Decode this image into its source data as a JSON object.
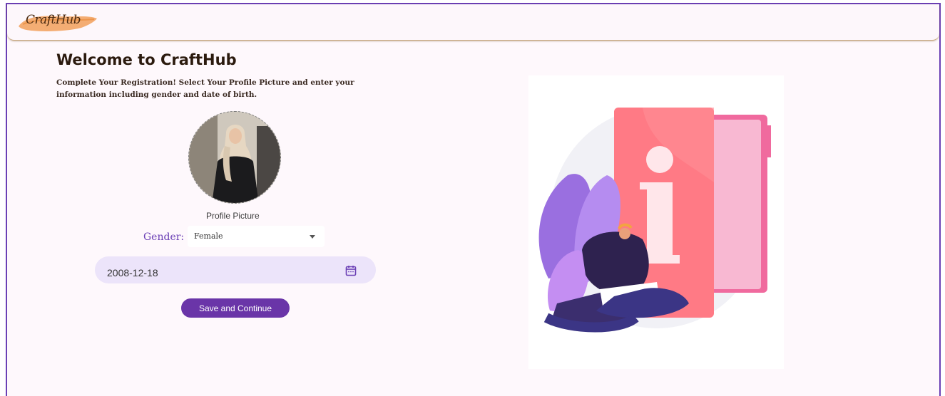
{
  "app": {
    "logo_text": "CraftHub",
    "accent_color": "#6a3fb5",
    "logo_brush_color": "#f2a05a"
  },
  "page": {
    "title": "Welcome to CraftHub",
    "subtitle": "Complete Your Registration! Select Your Profile Picture and enter your information including gender and date of birth."
  },
  "profile": {
    "picture_label": "Profile Picture"
  },
  "form": {
    "gender_label": "Gender:",
    "gender_value": "Female",
    "date_of_birth": "2008-12-18",
    "save_label": "Save and Continue"
  },
  "illustration": {
    "icon": "info-document-person-laptop-illustration"
  }
}
